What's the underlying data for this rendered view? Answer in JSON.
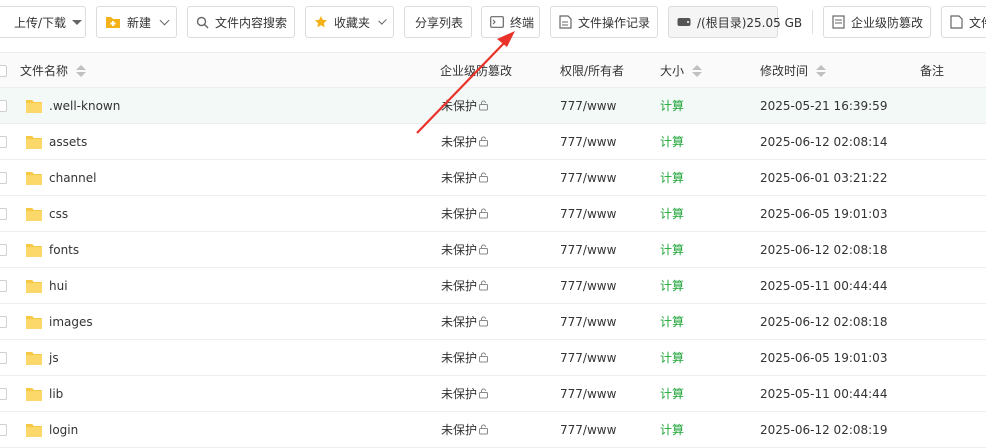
{
  "toolbar": {
    "upload_label": "上传/下载",
    "new_label": "新建",
    "search_label": "文件内容搜索",
    "favorites_label": "收藏夹",
    "share_label": "分享列表",
    "terminal_label": "终端",
    "oplog_label": "文件操作记录",
    "disk_label": "/(根目录)25.05 GB",
    "tamper_label": "企业级防篡改",
    "more_label": "文件"
  },
  "table": {
    "headers": {
      "name": "文件名称",
      "tamper": "企业级防篡改",
      "perm": "权限/所有者",
      "size": "大小",
      "mtime": "修改时间",
      "note": "备注"
    },
    "rows": [
      {
        "name": ".well-known",
        "tamper": "未保护",
        "perm": "777/www",
        "size": "计算",
        "mtime": "2025-05-21 16:39:59"
      },
      {
        "name": "assets",
        "tamper": "未保护",
        "perm": "777/www",
        "size": "计算",
        "mtime": "2025-06-12 02:08:14"
      },
      {
        "name": "channel",
        "tamper": "未保护",
        "perm": "777/www",
        "size": "计算",
        "mtime": "2025-06-01 03:21:22"
      },
      {
        "name": "css",
        "tamper": "未保护",
        "perm": "777/www",
        "size": "计算",
        "mtime": "2025-06-05 19:01:03"
      },
      {
        "name": "fonts",
        "tamper": "未保护",
        "perm": "777/www",
        "size": "计算",
        "mtime": "2025-06-12 02:08:18"
      },
      {
        "name": "hui",
        "tamper": "未保护",
        "perm": "777/www",
        "size": "计算",
        "mtime": "2025-05-11 00:44:44"
      },
      {
        "name": "images",
        "tamper": "未保护",
        "perm": "777/www",
        "size": "计算",
        "mtime": "2025-06-12 02:08:18"
      },
      {
        "name": "js",
        "tamper": "未保护",
        "perm": "777/www",
        "size": "计算",
        "mtime": "2025-06-05 19:01:03"
      },
      {
        "name": "lib",
        "tamper": "未保护",
        "perm": "777/www",
        "size": "计算",
        "mtime": "2025-05-11 00:44:44"
      },
      {
        "name": "login",
        "tamper": "未保护",
        "perm": "777/www",
        "size": "计算",
        "mtime": "2025-06-12 02:08:19"
      }
    ]
  },
  "colors": {
    "accent_green": "#20a53a",
    "folder_yellow": "#f7c945",
    "arrow_red": "#e8322a",
    "selected_row": "#f3f9f7"
  },
  "icons": [
    "upload-icon",
    "new-folder-icon",
    "search-icon",
    "star-icon",
    "terminal-icon",
    "file-log-icon",
    "disk-icon",
    "shield-icon",
    "folder-icon",
    "lock-icon",
    "sort-icon"
  ]
}
